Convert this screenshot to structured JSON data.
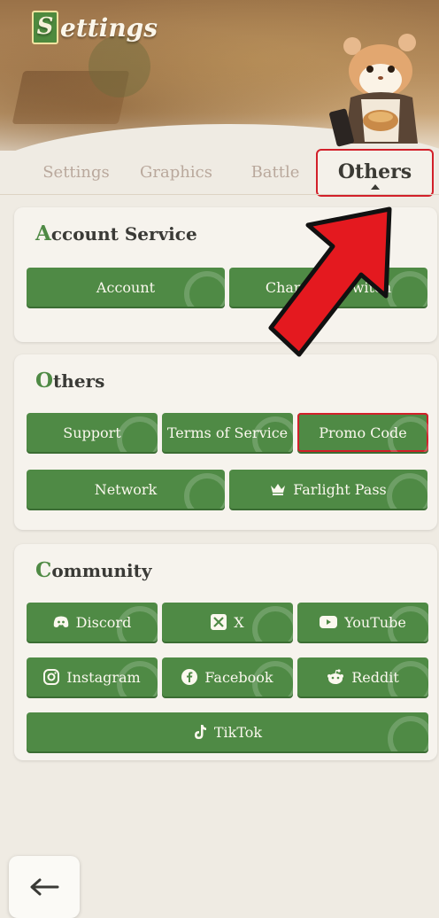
{
  "header": {
    "title_initial": "S",
    "title_rest": "ettings"
  },
  "tabs": [
    {
      "label": "Settings",
      "active": false
    },
    {
      "label": "Graphics",
      "active": false
    },
    {
      "label": "Battle",
      "active": false
    },
    {
      "label": "Others",
      "active": true
    }
  ],
  "account_service": {
    "title_initial": "A",
    "title_rest": "ccount Service",
    "buttons": [
      {
        "label": "Account"
      },
      {
        "label": "Character Switch"
      }
    ]
  },
  "others": {
    "title_initial": "O",
    "title_rest": "thers",
    "buttons": [
      {
        "label": "Support"
      },
      {
        "label": "Terms of Service"
      },
      {
        "label": "Promo Code",
        "highlighted": true
      },
      {
        "label": "Network"
      },
      {
        "label": "Farlight Pass",
        "icon": "crown-icon"
      }
    ]
  },
  "community": {
    "title_initial": "C",
    "title_rest": "ommunity",
    "buttons": [
      {
        "label": "Discord",
        "icon": "discord-icon"
      },
      {
        "label": "X",
        "icon": "x-icon"
      },
      {
        "label": "YouTube",
        "icon": "youtube-icon"
      },
      {
        "label": "Instagram",
        "icon": "instagram-icon"
      },
      {
        "label": "Facebook",
        "icon": "facebook-icon"
      },
      {
        "label": "Reddit",
        "icon": "reddit-icon"
      },
      {
        "label": "TikTok",
        "icon": "tiktok-icon"
      }
    ]
  },
  "colors": {
    "accent_green": "#4f8a45",
    "highlight_red": "#d2202a",
    "background": "#efebe3"
  }
}
